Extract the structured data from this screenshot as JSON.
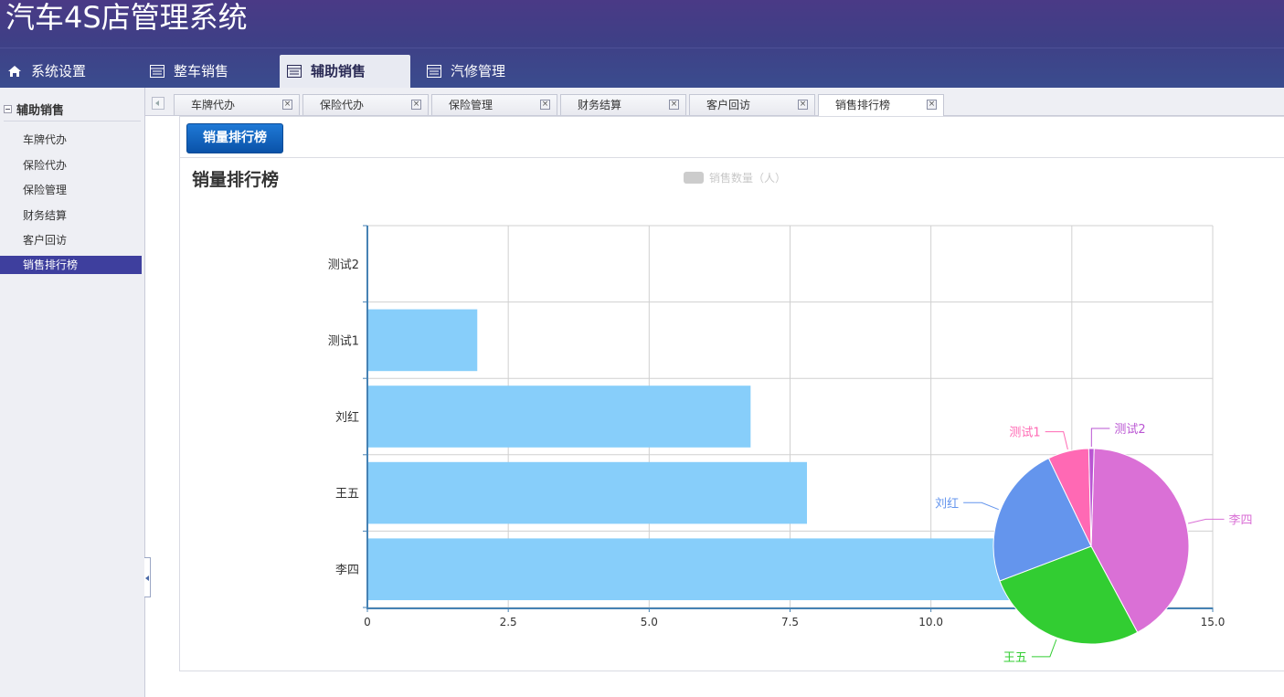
{
  "app": {
    "title": "汽车4S店管理系统"
  },
  "topnav": [
    {
      "label": "系统设置",
      "icon": "home-icon"
    },
    {
      "label": "整车销售",
      "icon": "table-icon"
    },
    {
      "label": "辅助销售",
      "icon": "table-icon",
      "active": true
    },
    {
      "label": "汽修管理",
      "icon": "table-icon"
    }
  ],
  "sidebar": {
    "heading": "辅助销售",
    "items": [
      "车牌代办",
      "保险代办",
      "保险管理",
      "财务结算",
      "客户回访",
      "销售排行榜"
    ],
    "active_index": 5
  },
  "tabs": [
    "车牌代办",
    "保险代办",
    "保险管理",
    "财务结算",
    "客户回访",
    "销售排行榜"
  ],
  "active_tab": 5,
  "toolbar": {
    "button_label": "销量排行榜"
  },
  "chart_data": [
    {
      "type": "bar",
      "orientation": "horizontal",
      "title": "销量排行榜",
      "legend": "销售数量（人）",
      "categories": [
        "测试2",
        "测试1",
        "刘红",
        "王五",
        "李四"
      ],
      "values": [
        0,
        1.95,
        6.8,
        7.8,
        12
      ],
      "xlim": [
        0,
        15
      ],
      "xticks": [
        "0",
        "2.5",
        "5.0",
        "7.5",
        "10.0",
        "12.5",
        "15.0"
      ],
      "grid": true,
      "color": "#87cefa"
    },
    {
      "type": "pie",
      "slices": [
        {
          "name": "李四",
          "value": 12,
          "color": "#da70d6"
        },
        {
          "name": "王五",
          "value": 7.8,
          "color": "#32cd32"
        },
        {
          "name": "刘红",
          "value": 6.8,
          "color": "#6495ed"
        },
        {
          "name": "测试1",
          "value": 1.95,
          "color": "#ff69b4"
        },
        {
          "name": "测试2",
          "value": 0.25,
          "color": "#ba55d3"
        }
      ]
    }
  ]
}
